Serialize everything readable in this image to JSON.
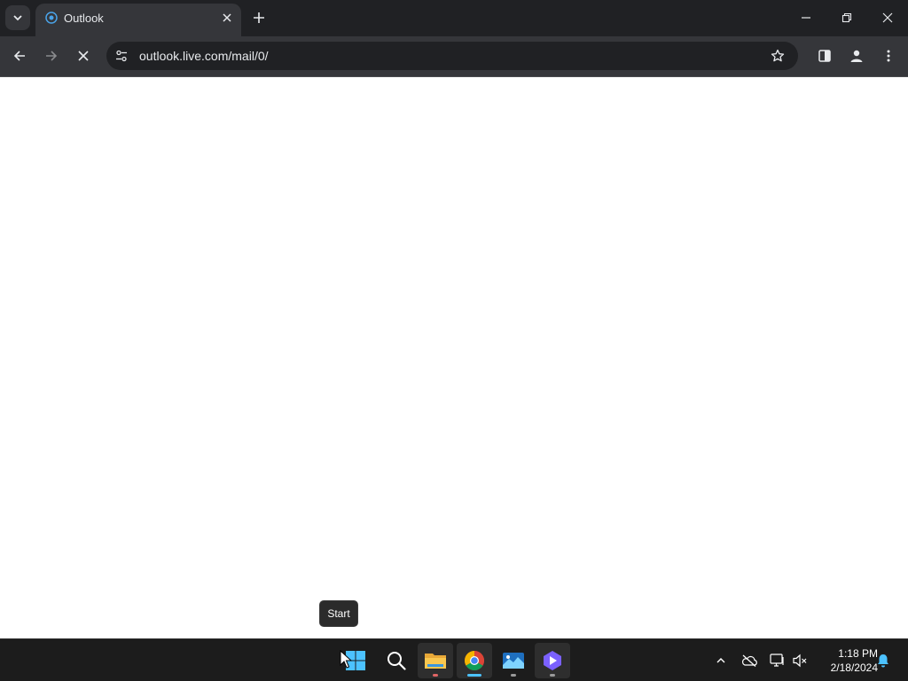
{
  "browser": {
    "tab": {
      "title": "Outlook",
      "favicon": "outlook-icon"
    },
    "address_bar": {
      "url": "outlook.live.com/mail/0/"
    }
  },
  "tooltip": {
    "text": "Start"
  },
  "taskbar": {
    "apps": [
      "windows-start-icon",
      "search-icon",
      "file-explorer-icon",
      "chrome-icon",
      "photos-icon",
      "clipchamp-icon"
    ],
    "clock": {
      "time": "1:18 PM",
      "date": "2/18/2024"
    }
  },
  "colors": {
    "chrome_dark": "#202124",
    "chrome_toolbar": "#35363a",
    "taskbar_bg": "#1c1c1c",
    "accent": "#4cc2ff"
  }
}
